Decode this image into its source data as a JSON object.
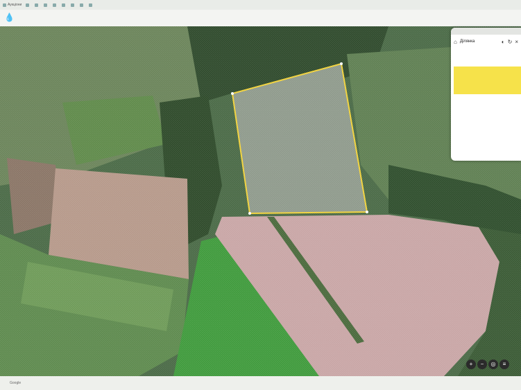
{
  "bookmarks": [
    {
      "label": "Аукціони"
    },
    {
      "label": ""
    },
    {
      "label": ""
    },
    {
      "label": ""
    },
    {
      "label": ""
    },
    {
      "label": ""
    },
    {
      "label": ""
    },
    {
      "label": ""
    },
    {
      "label": ""
    }
  ],
  "panel": {
    "top_label": "",
    "title": "Ділянка",
    "description": "",
    "note": "",
    "note_button": "",
    "fields": [
      {
        "label": "",
        "value": ""
      },
      {
        "label": "",
        "value": ""
      }
    ]
  },
  "status": {
    "left": [
      "Google",
      "",
      "",
      ""
    ]
  },
  "colors": {
    "parcel_outline": "#f2d23a",
    "note_bg": "#f6e24a"
  },
  "icons": [
    "drop-icon",
    "home-icon",
    "close-icon",
    "refresh-icon",
    "zoom-in-icon",
    "zoom-out-icon",
    "layers-icon"
  ]
}
